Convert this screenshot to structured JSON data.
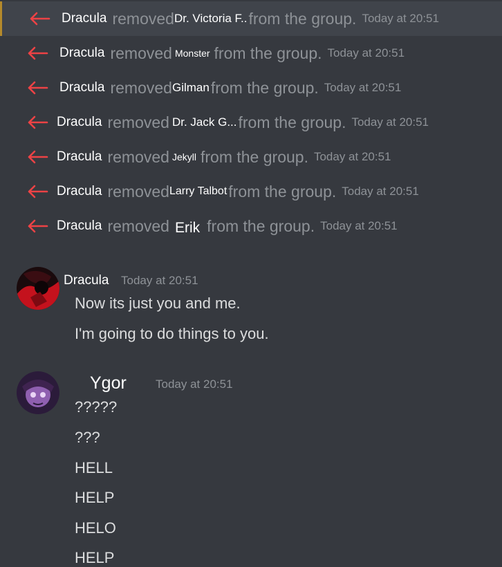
{
  "system_messages": [
    {
      "actor": "Dracula",
      "verb": "removed",
      "target": "Dr. Victoria F..",
      "tail": "from the group.",
      "time": "Today at 20:51"
    },
    {
      "actor": "Dracula",
      "verb": "removed",
      "target": "Monster",
      "tail": "from the group.",
      "time": "Today at 20:51"
    },
    {
      "actor": "Dracula",
      "verb": "removed",
      "target": "Gilman",
      "tail": "from the group.",
      "time": "Today at 20:51"
    },
    {
      "actor": "Dracula",
      "verb": "removed",
      "target": "Dr. Jack G...",
      "tail": "from the group.",
      "time": "Today at 20:51"
    },
    {
      "actor": "Dracula",
      "verb": "removed",
      "target": "Jekyll",
      "tail": "from the group.",
      "time": "Today at 20:51"
    },
    {
      "actor": "Dracula",
      "verb": "removed",
      "target": "Larry Talbot",
      "tail": "from the group.",
      "time": "Today at 20:51"
    },
    {
      "actor": "Dracula",
      "verb": "removed",
      "target": "Erik",
      "tail": "from the group.",
      "time": "Today at 20:51"
    }
  ],
  "messages": [
    {
      "author": "Dracula",
      "time": "Today at 20:51",
      "lines": [
        "Now its just you and me.",
        "I'm going to do things to you."
      ]
    },
    {
      "author": "Ygor",
      "time": "Today at 20:51",
      "lines": [
        "?????",
        "???",
        "HELL",
        "HELP",
        "HELO",
        "HELP"
      ]
    }
  ],
  "colors": {
    "background": "#36393f",
    "highlight_row": "#40444b",
    "highlight_border": "#b58a2b",
    "leave_arrow": "#ed4245",
    "muted_text": "#8e9297"
  },
  "icons": {
    "leave": "arrow-left-icon"
  }
}
